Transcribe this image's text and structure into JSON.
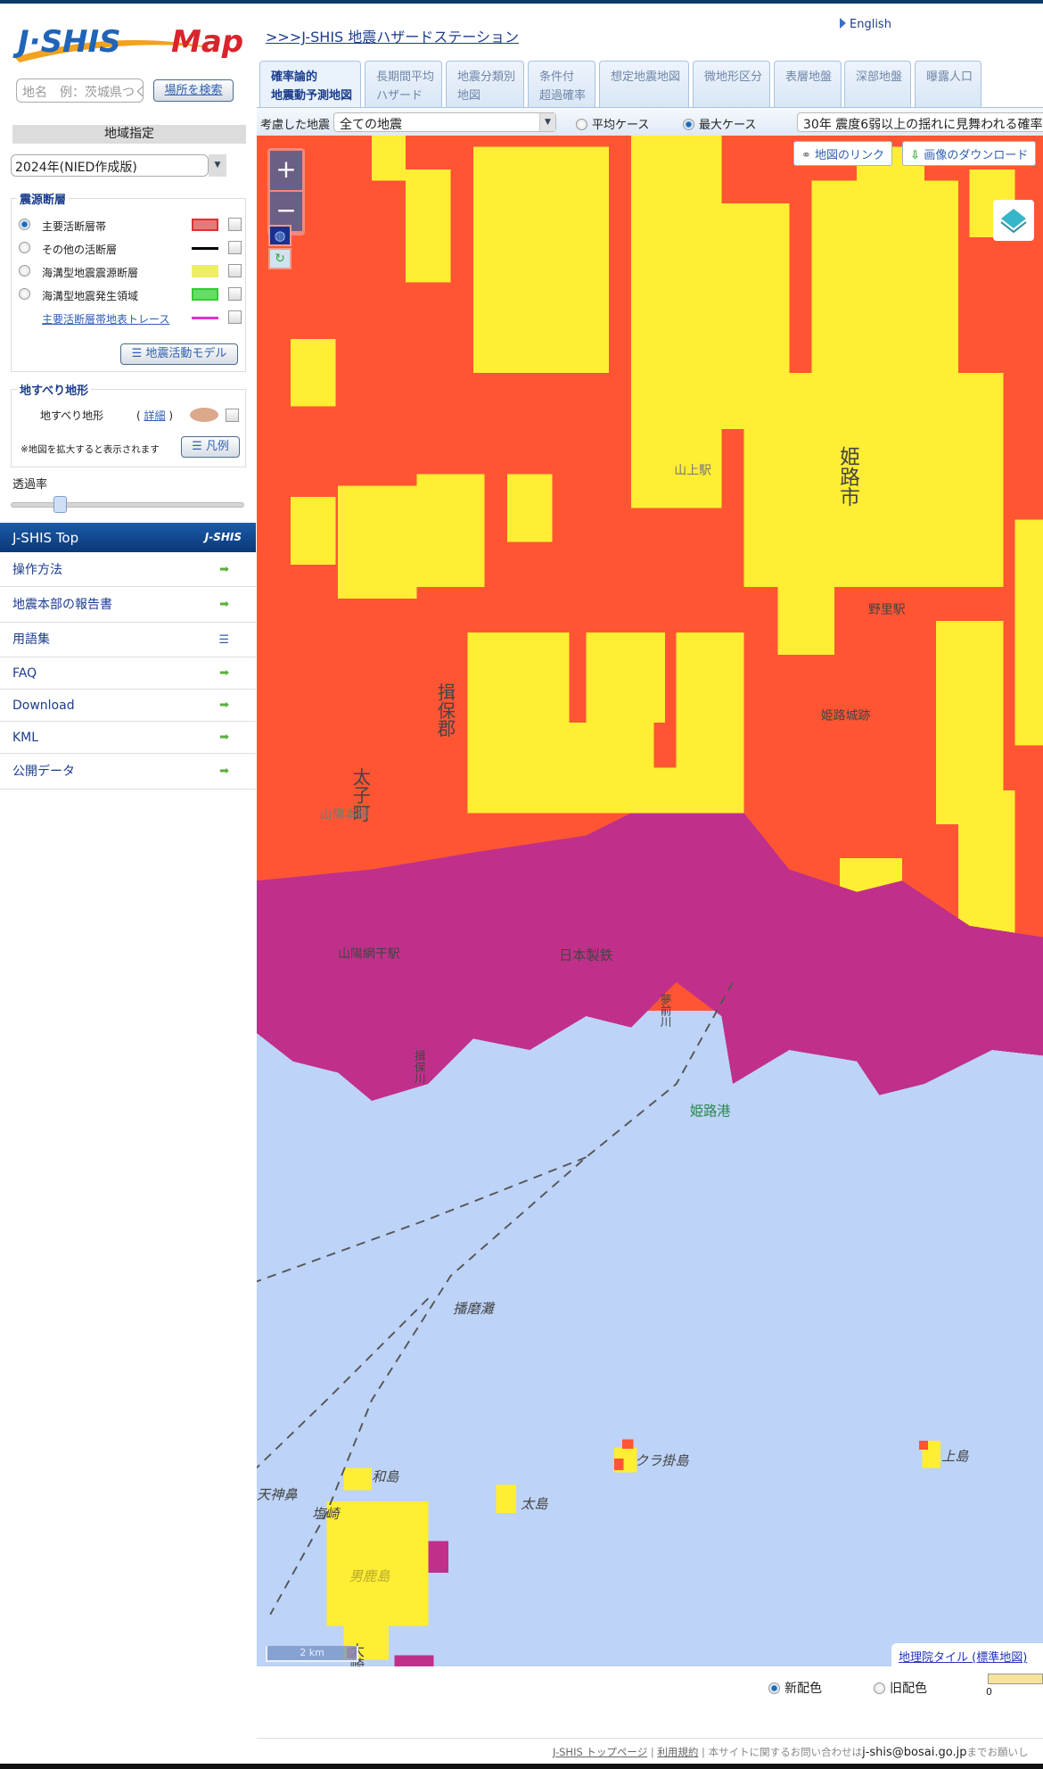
{
  "header": {
    "logo_text": "J-SHIS Map",
    "station_link": ">>>J-SHIS 地震ハザードステーション",
    "english": "English"
  },
  "tabs": [
    {
      "line1": "確率論的",
      "line2": "地震動予測地図",
      "active": true
    },
    {
      "line1": "長期間平均",
      "line2": "ハザード"
    },
    {
      "line1": "地震分類別",
      "line2": "地図"
    },
    {
      "line1": "条件付",
      "line2": "超過確率"
    },
    {
      "line1": "想定地震地図",
      "line2": ""
    },
    {
      "line1": "微地形区分",
      "line2": ""
    },
    {
      "line1": "表層地盤",
      "line2": ""
    },
    {
      "line1": "深部地盤",
      "line2": ""
    },
    {
      "line1": "曝露人口",
      "line2": ""
    }
  ],
  "toolbar": {
    "quake_label": "考慮した地震",
    "quake_value": "全ての地震",
    "avg_case": "平均ケース",
    "max_case": "最大ケース",
    "selected_case": "max",
    "prob_value": "30年 震度6弱以上の揺れに見舞われる確率"
  },
  "sidebar": {
    "search_placeholder": "地名　例：茨城県つくば市",
    "search_button": "場所を検索",
    "region_title": "地域指定",
    "year_value": "2024年(NIED作成版)",
    "fault": {
      "title": "震源断層",
      "items": [
        {
          "label": "主要活断層帯",
          "selected": true,
          "color": "#e87878"
        },
        {
          "label": "その他の活断層",
          "color": "#000000"
        },
        {
          "label": "海溝型地震震源断層",
          "color": "#eeee66"
        },
        {
          "label": "海溝型地震発生領域",
          "color": "#66dd66"
        },
        {
          "label": "主要活断層帯地表トレース",
          "color": "#dd33cc",
          "link": true
        }
      ],
      "model_button": "地震活動モデル"
    },
    "landslide": {
      "title": "地すべり地形",
      "label": "地すべり地形",
      "detail_open": "(",
      "detail": "詳細",
      "detail_close": ")",
      "note": "※地図を拡大すると表示されます",
      "legend_button": "凡例",
      "color": "#dca88c"
    },
    "opacity_label": "透過率",
    "opacity_value": 0.2,
    "top_bar": "J-SHIS Top",
    "top_bar_logo": "J-SHIS",
    "menu": [
      {
        "label": "操作方法",
        "icon": "arrow-right-icon"
      },
      {
        "label": "地震本部の報告書",
        "icon": "arrow-right-icon"
      },
      {
        "label": "用語集",
        "icon": "document-icon"
      },
      {
        "label": "FAQ",
        "icon": "arrow-right-icon"
      },
      {
        "label": "Download",
        "icon": "arrow-right-icon"
      },
      {
        "label": "KML",
        "icon": "arrow-right-icon"
      },
      {
        "label": "公開データ",
        "icon": "arrow-right-icon"
      }
    ]
  },
  "map": {
    "link_button": "地図のリンク",
    "download_button": "画像のダウンロード",
    "zoom_in": "+",
    "zoom_out": "−",
    "scale": "2 km",
    "attribution": "地理院タイル (標準地図)",
    "colors": {
      "high": "#ff5533",
      "very_high": "#c0308a",
      "mid": "#ffee33",
      "sea": "#bdd3f7"
    },
    "labels": {
      "himeji_city": "姫路市",
      "nozato": "野里駅",
      "castle": "姫路城跡",
      "taishi": "太子町",
      "ibo": "揖保郡",
      "nippon_steel": "日本製鉄",
      "aboshi": "山陽網干駅",
      "port": "姫路港",
      "harima": "播磨灘",
      "kurakake": "クラ掛島",
      "kamishima": "上島",
      "futoshima": "太島",
      "washima": "和島",
      "tanjinbana": "天神鼻",
      "shiosaki": "塩崎",
      "tanga": "男鹿島",
      "osaki": "大崎",
      "yamanoue": "山上駅",
      "sanyo_line": "山陽本線",
      "ibo_river": "揖保川",
      "yumesaki_river": "夢前川"
    }
  },
  "legend": {
    "new_color": "新配色",
    "old_color": "旧配色",
    "selected": "new",
    "scale_start": "0"
  },
  "footer": {
    "top_link": "J-SHIS トップページ",
    "terms": "利用規約",
    "sep": "|",
    "contact_text": "本サイトに関するお問い合わせは",
    "email": "j-shis@bosai.go.jp",
    "tail": "までお願いし"
  }
}
